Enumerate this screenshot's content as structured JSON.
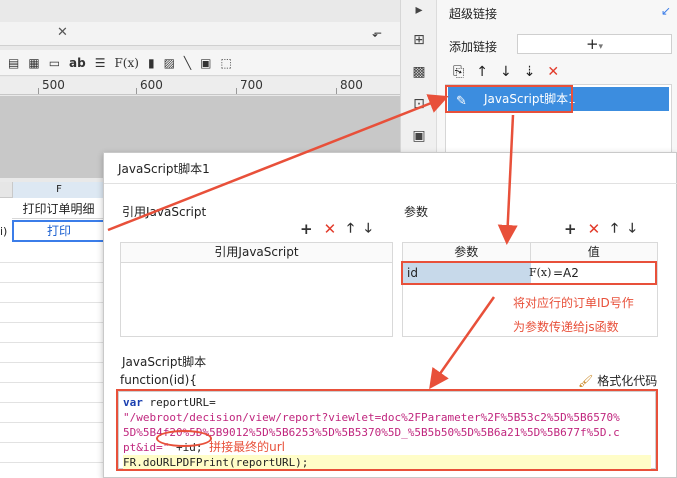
{
  "designer": {
    "ruler_labels": [
      "500",
      "600",
      "700",
      "800"
    ],
    "column_letter": "F",
    "header_cell": "打印订单明细",
    "cut_cell": "i)",
    "print_cell": "打印"
  },
  "toolbar_icons": [
    "table-icon",
    "grid-icon",
    "text-icon",
    "bold-ab-icon",
    "align-icon",
    "formula-icon",
    "chart-icon",
    "image-icon",
    "line-icon",
    "rect-icon",
    "border-icon"
  ],
  "toolbar_text": {
    "ab": "ab",
    "fx": "F(x)"
  },
  "right_panel": {
    "title": "超级链接",
    "add_label": "添加链接",
    "add_button": "+",
    "item_label": "JavaScript脚本1"
  },
  "dialog": {
    "title": "JavaScript脚本1",
    "ref_section": "引用JavaScript",
    "ref_column": "引用JavaScript",
    "param_section": "参数",
    "param_col_name": "参数",
    "param_col_value": "值",
    "param_name": "id",
    "param_fx": "F(x)",
    "param_value": "=A2",
    "script_section": "JavaScript脚本",
    "function_sig": "function(id){",
    "format_button": "格式化代码"
  },
  "annotations": {
    "param_note_line1": "将对应行的订单ID号作",
    "param_note_line2": "为参数传递给js函数",
    "code_note": "拼接最终的url"
  },
  "code": {
    "line1_kw": "var",
    "line1_rest": " reportURL=",
    "line2": "\"/webroot/decision/view/report?viewlet=doc%2FParameter%2F%5B53c2%5D%5B6570%",
    "line3": "5D%5B4f20%5D%5B9012%5D%5B6253%5D%5B5370%5D_%5B5b50%5D%5B6a21%5D%5B677f%5D.c",
    "line4_a": "pt",
    "line4_b": "&id=\"",
    "line4_c": " +id;",
    "line5": "FR.doURLPDFPrint(reportURL);"
  }
}
